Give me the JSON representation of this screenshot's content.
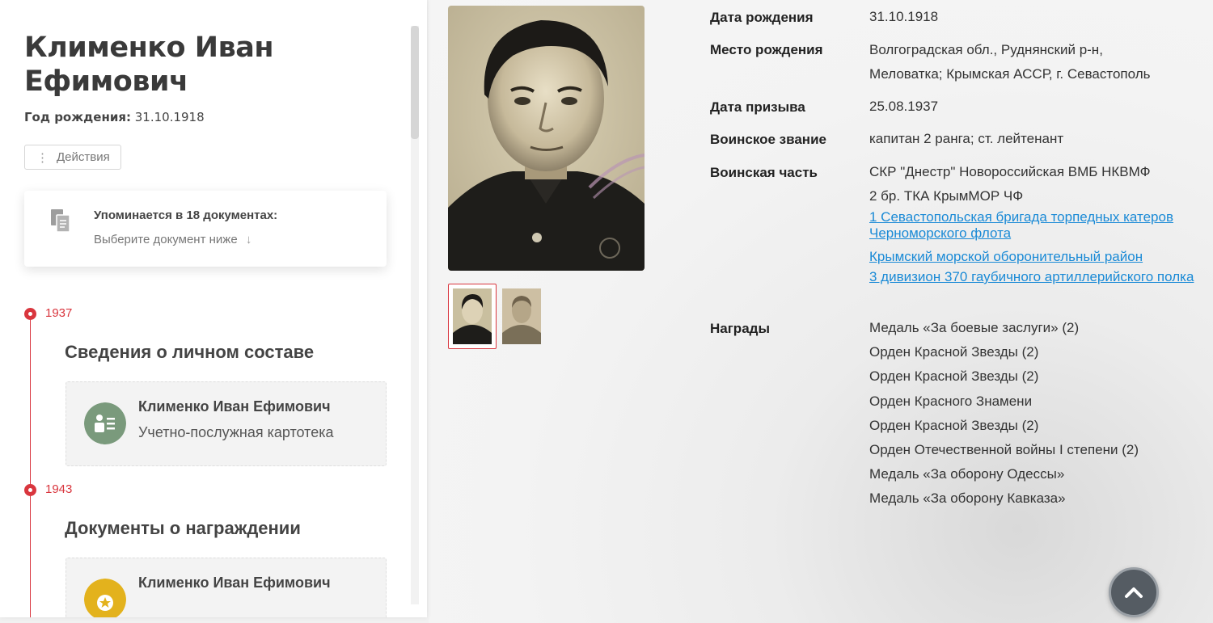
{
  "person": {
    "name": "Клименко Иван Ефимович",
    "birth_label": "Год рождения:",
    "birth_value": "31.10.1918"
  },
  "actions": {
    "dots": "⋮",
    "label": "Действия"
  },
  "mentions": {
    "title": "Упоминается в 18 документах:",
    "subtitle": "Выберите документ ниже",
    "arrow": "↓"
  },
  "timeline": [
    {
      "year": "1937",
      "section": "Сведения о личном составе",
      "card": {
        "name": "Клименко Иван Ефимович",
        "type": "Учетно-послужная картотека",
        "icon": "person-list-icon",
        "color": "#7a9a7c"
      }
    },
    {
      "year": "1943",
      "section": "Документы о награждении",
      "card": {
        "name": "Клименко Иван Ефимович",
        "type": "",
        "icon": "medal-icon",
        "color": "#e3b21d"
      }
    }
  ],
  "info": {
    "birth_date": {
      "label": "Дата рождения",
      "value": "31.10.1918"
    },
    "birth_place": {
      "label": "Место рождения",
      "value_line1": "Волгоградская обл., Руднянский р-н,",
      "value_line2": "Меловатка; Крымская АССР, г. Севастополь"
    },
    "draft_date": {
      "label": "Дата призыва",
      "value": "25.08.1937"
    },
    "rank": {
      "label": "Воинское звание",
      "value": "капитан 2 ранга; ст. лейтенант"
    },
    "unit": {
      "label": "Воинская часть",
      "line1": "СКР \"Днестр\" Новороссийская ВМБ НКВМФ",
      "line2": "2 бр. ТКА КрымМОР ЧФ",
      "links": [
        "1 Севастопольская бригада торпедных катеров Черноморского флота",
        "Крымский морской оборонительный район",
        "3 дивизион 370 гаубичного артиллерийского полка"
      ]
    },
    "awards": {
      "label": "Награды",
      "items": [
        "Медаль «За боевые заслуги» (2)",
        "Орден Красной Звезды (2)",
        "Орден Красной Звезды (2)",
        "Орден Красного Знамени",
        "Орден Красной Звезды (2)",
        "Орден Отечественной войны I степени (2)",
        "Медаль «За оборону Одессы»",
        "Медаль «За оборону Кавказа»"
      ]
    }
  },
  "colors": {
    "accent": "#d9363e",
    "link": "#1a8ad6"
  }
}
